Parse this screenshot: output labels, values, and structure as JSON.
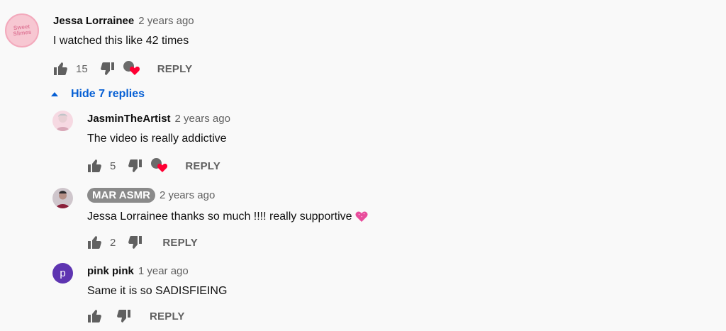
{
  "top_comment": {
    "avatar_text": "Sweet Slimes",
    "author": "Jessa Lorrainee",
    "time": "2 years ago",
    "text": "I watched this like 42 times",
    "likes": "15",
    "reply_label": "REPLY"
  },
  "replies_toggle": {
    "label": "Hide 7 replies"
  },
  "replies": [
    {
      "author": "JasminTheArtist",
      "time": "2 years ago",
      "text": "The video is really addictive",
      "likes": "5",
      "reply_label": "REPLY"
    },
    {
      "author": "MAR ASMR",
      "time": "2 years ago",
      "text": "Jessa Lorrainee thanks so much !!!! really supportive",
      "likes": "2",
      "reply_label": "REPLY"
    },
    {
      "author": "pink pink",
      "avatar_letter": "p",
      "time": "1 year ago",
      "text": "Same it is so SADISFIEING",
      "reply_label": "REPLY"
    }
  ],
  "colors": {
    "background": "#f9f9f9",
    "link_blue": "#065fd4",
    "heart_red": "#ff0033",
    "meta_gray": "#606060",
    "badge_gray": "#8a8a8a",
    "pink_avatar": "#5e35b1"
  }
}
